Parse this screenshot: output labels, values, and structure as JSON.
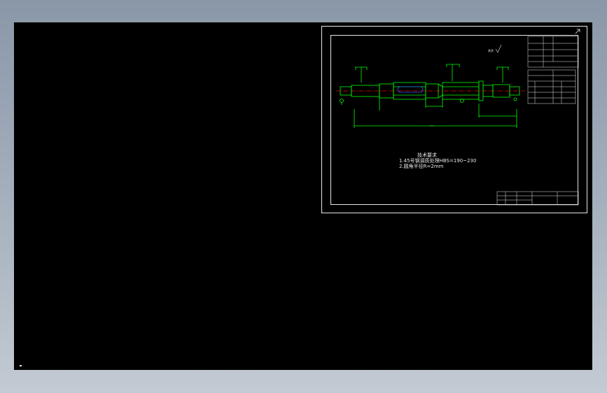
{
  "viewport": {
    "background_color": "#000000",
    "ui_background": "#a7b2bf"
  },
  "drawing": {
    "line_color": "#e6e6e6",
    "shaft_color": "#00ff00",
    "centerline_color": "#ff0000",
    "keyway_color": "#3355ff",
    "technical_requirements": {
      "title": "技术要求",
      "line1": "1.45号钢调质处理HBS=190~230",
      "line2": "2.圆角半径R=2mm"
    }
  }
}
